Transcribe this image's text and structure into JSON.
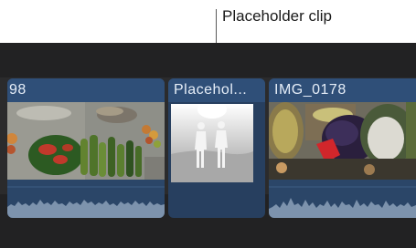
{
  "callout": {
    "label": "Placeholder clip"
  },
  "clips": [
    {
      "title": "98"
    },
    {
      "title": "Placehol..."
    },
    {
      "title": "IMG_0178"
    }
  ],
  "colors": {
    "timeline_bg": "#222223",
    "clip_header": "#2f4f78",
    "clip_body": "#2d4868",
    "waveform": "#7d93ad"
  }
}
